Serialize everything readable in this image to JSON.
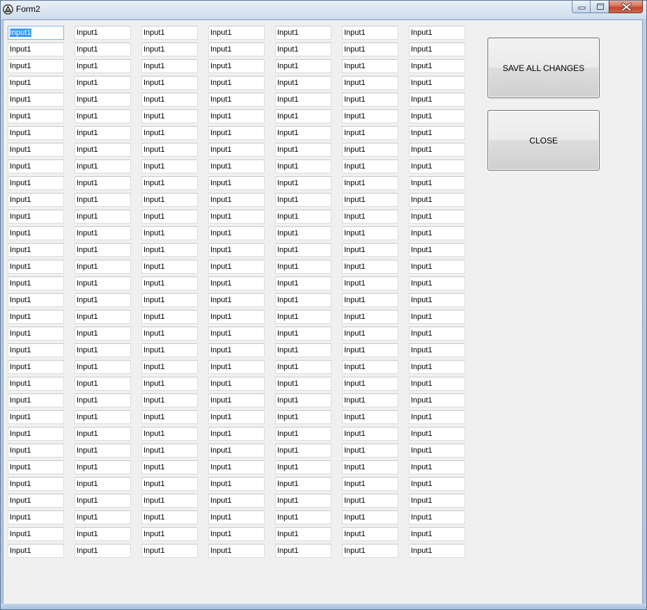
{
  "window": {
    "title": "Form2"
  },
  "form": {
    "columns": 7,
    "rows": 32,
    "field_value": "Input1",
    "focused_field": "row 1, column 1 (text selected)"
  },
  "buttons": {
    "save_label": "SAVE ALL CHANGES",
    "close_label": "CLOSE"
  },
  "colors": {
    "selection": "#3399ff",
    "close_button": "#c7482d",
    "client_background": "#f0f0f0"
  },
  "icons": {
    "app": "app-logo-icon",
    "minimize": "minimize-icon",
    "maximize": "maximize-icon",
    "close": "close-icon"
  }
}
